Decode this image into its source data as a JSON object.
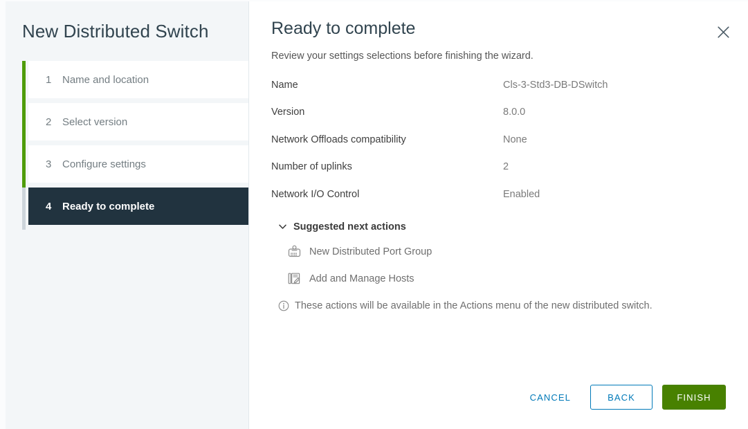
{
  "sidebar": {
    "title": "New Distributed Switch",
    "steps": [
      {
        "num": "1",
        "label": "Name and location"
      },
      {
        "num": "2",
        "label": "Select version"
      },
      {
        "num": "3",
        "label": "Configure settings"
      },
      {
        "num": "4",
        "label": "Ready to complete"
      }
    ]
  },
  "header": {
    "title": "Ready to complete",
    "subtitle": "Review your settings selections before finishing the wizard.",
    "close_icon": "close-icon"
  },
  "summary": {
    "rows": [
      {
        "key": "Name",
        "value": "Cls-3-Std3-DB-DSwitch"
      },
      {
        "key": "Version",
        "value": "8.0.0"
      },
      {
        "key": "Network Offloads compatibility",
        "value": "None"
      },
      {
        "key": "Number of uplinks",
        "value": "2"
      },
      {
        "key": "Network I/O Control",
        "value": "Enabled"
      }
    ]
  },
  "suggested": {
    "header": "Suggested next actions",
    "expanded": true,
    "chevron_icon": "chevron-down-icon",
    "actions": [
      {
        "label": "New Distributed Port Group",
        "icon": "port-group-icon"
      },
      {
        "label": "Add and Manage Hosts",
        "icon": "add-manage-hosts-icon"
      }
    ],
    "note_icon": "info-circle-icon",
    "note": "These actions will be available in the Actions menu of the new distributed switch."
  },
  "footer": {
    "cancel_label": "CANCEL",
    "back_label": "BACK",
    "finish_label": "FINISH"
  },
  "colors": {
    "accent_blue": "#0079b8",
    "primary_green": "#488100",
    "progress_green": "#4f9c0a",
    "active_step_bg": "#21333f",
    "sidebar_bg": "#f3f6f8"
  }
}
